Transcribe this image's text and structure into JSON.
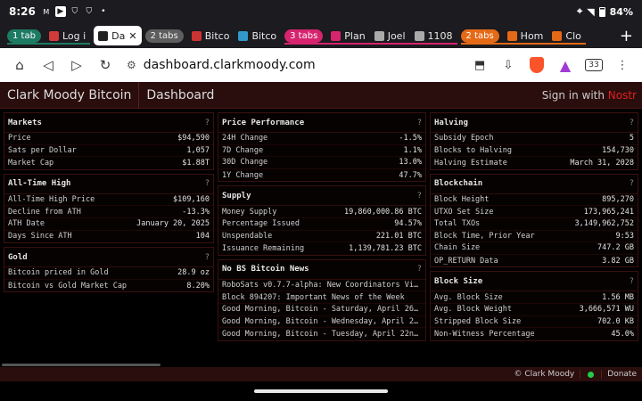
{
  "status": {
    "time": "8:26",
    "battery": "84%"
  },
  "tabs": [
    {
      "group": "1 tab",
      "group_color": "#1d7a63",
      "group_text": "#ffffff",
      "line": "#1d7a63",
      "items": [
        {
          "label": "Log i",
          "fav": "#d23b3b"
        }
      ]
    },
    {
      "group": "",
      "items": [
        {
          "label": "Da",
          "fav": "#222222",
          "active": true
        }
      ]
    },
    {
      "group": "2 tabs",
      "group_color": "#5e5e5e",
      "group_text": "#eeeeee",
      "items": [
        {
          "label": "Bitco",
          "fav": "#cc3333"
        },
        {
          "label": "Bitco",
          "fav": "#3399cc"
        }
      ]
    },
    {
      "group": "3 tabs",
      "group_color": "#d6246e",
      "group_text": "#ffffff",
      "line": "#d6246e",
      "items": [
        {
          "label": "Plan",
          "fav": "#d6246e"
        },
        {
          "label": "Joel",
          "fav": "#aaaaaa"
        },
        {
          "label": "1108",
          "fav": "#aaaaaa"
        }
      ]
    },
    {
      "group": "2 tabs",
      "group_color": "#e56a17",
      "group_text": "#ffffff",
      "line": "#e56a17",
      "items": [
        {
          "label": "Hom",
          "fav": "#e56a17"
        },
        {
          "label": "Clo",
          "fav": "#e56a17"
        }
      ]
    }
  ],
  "address": {
    "url": "dashboard.clarkmoody.com",
    "tabs_count": "33"
  },
  "header": {
    "brand": "Clark Moody Bitcoin",
    "page": "Dashboard",
    "signin": "Sign in with ",
    "signin_accent": "Nostr"
  },
  "columns": [
    [
      {
        "title": "Markets",
        "rows": [
          [
            "Price",
            "$94,590"
          ],
          [
            "Sats per Dollar",
            "1,057"
          ],
          [
            "Market Cap",
            "$1.88T"
          ]
        ]
      },
      {
        "title": "All-Time High",
        "rows": [
          [
            "All-Time High Price",
            "$109,160"
          ],
          [
            "Decline from ATH",
            "-13.3%"
          ],
          [
            "ATH Date",
            "January 20, 2025"
          ],
          [
            "Days Since ATH",
            "104"
          ]
        ]
      },
      {
        "title": "Gold",
        "rows": [
          [
            "Bitcoin priced in Gold",
            "28.9 oz"
          ],
          [
            "Bitcoin vs Gold Market Cap",
            "8.20%"
          ]
        ]
      }
    ],
    [
      {
        "title": "Price Performance",
        "rows": [
          [
            "24H Change",
            "-1.5%"
          ],
          [
            "7D Change",
            "1.1%"
          ],
          [
            "30D Change",
            "13.0%"
          ],
          [
            "1Y Change",
            "47.7%"
          ]
        ]
      },
      {
        "title": "Supply",
        "rows": [
          [
            "Money Supply",
            "19,860,000.86 BTC"
          ],
          [
            "Percentage Issued",
            "94.57%"
          ],
          [
            "Unspendable",
            "221.01 BTC"
          ],
          [
            "Issuance Remaining",
            "1,139,781.23 BTC"
          ]
        ]
      },
      {
        "title": "No BS Bitcoin News",
        "news": true,
        "rows": [
          [
            "RoboSats v0.7.7-alpha: New Coordinators View...",
            ""
          ],
          [
            "Block 894207: Important News of the Week",
            ""
          ],
          [
            "Good Morning, Bitcoin - Saturday, April 26th...",
            ""
          ],
          [
            "Good Morning, Bitcoin - Wednesday, April 23r...",
            ""
          ],
          [
            "Good Morning, Bitcoin - Tuesday, April 22nd,...",
            ""
          ]
        ]
      }
    ],
    [
      {
        "title": "Halving",
        "rows": [
          [
            "Subsidy Epoch",
            "5"
          ],
          [
            "Blocks to Halving",
            "154,730"
          ],
          [
            "Halving Estimate",
            "March 31, 2028"
          ]
        ]
      },
      {
        "title": "Blockchain",
        "rows": [
          [
            "Block Height",
            "895,270"
          ],
          [
            "UTXO Set Size",
            "173,965,241"
          ],
          [
            "Total TXOs",
            "3,149,962,752"
          ],
          [
            "Block Time, Prior Year",
            "9:53"
          ],
          [
            "Chain Size",
            "747.2 GB"
          ],
          [
            "OP_RETURN Data",
            "3.82 GB"
          ]
        ]
      },
      {
        "title": "Block Size",
        "rows": [
          [
            "Avg. Block Size",
            "1.56 MB"
          ],
          [
            "Avg. Block Weight",
            "3,666,571 WU"
          ],
          [
            "Stripped Block Size",
            "702.0 KB"
          ],
          [
            "Non-Witness Percentage",
            "45.0%"
          ]
        ]
      }
    ]
  ],
  "footer": {
    "copyright": "© Clark Moody",
    "donate": "Donate"
  }
}
